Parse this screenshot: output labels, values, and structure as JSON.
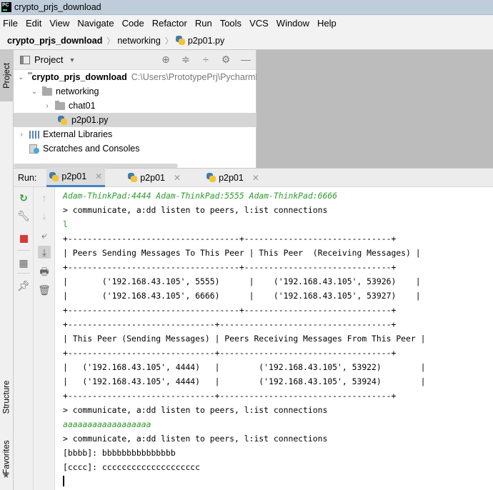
{
  "window": {
    "title": "crypto_prjs_download"
  },
  "menu": [
    {
      "label": "File"
    },
    {
      "label": "Edit"
    },
    {
      "label": "View"
    },
    {
      "label": "Navigate"
    },
    {
      "label": "Code"
    },
    {
      "label": "Refactor"
    },
    {
      "label": "Run"
    },
    {
      "label": "Tools"
    },
    {
      "label": "VCS"
    },
    {
      "label": "Window"
    },
    {
      "label": "Help"
    }
  ],
  "breadcrumb": {
    "root": "crypto_prjs_download",
    "folder": "networking",
    "file": "p2p01.py"
  },
  "side_tabs": {
    "project": "Project",
    "structure": "Structure",
    "favorites": "Favorites"
  },
  "project_panel": {
    "title": "Project",
    "tree": [
      {
        "label": "crypto_prjs_download",
        "path": "C:\\Users\\PrototypePrj\\PycharmP"
      },
      {
        "label": "networking"
      },
      {
        "label": "chat01"
      },
      {
        "label": "p2p01.py"
      },
      {
        "label": "External Libraries"
      },
      {
        "label": "Scratches and Consoles"
      }
    ]
  },
  "run": {
    "label": "Run:",
    "tabs": [
      {
        "label": "p2p01"
      },
      {
        "label": "p2p01"
      },
      {
        "label": "p2p01"
      }
    ]
  },
  "console": {
    "lines": [
      "Adam-ThinkPad:4444 Adam-ThinkPad:5555 Adam-ThinkPad:6666",
      "> communicate, a:dd listen to peers, l:ist connections",
      "l",
      "+-----------------------------------+------------------------------+",
      "| Peers Sending Messages To This Peer | This Peer  (Receiving Messages) |",
      "+-----------------------------------+------------------------------+",
      "|       ('192.168.43.105', 5555)      |    ('192.168.43.105', 53926)    |",
      "|       ('192.168.43.105', 6666)      |    ('192.168.43.105', 53927)    |",
      "+-----------------------------------+------------------------------+",
      "+------------------------------+-----------------------------------+",
      "| This Peer (Sending Messages) | Peers Receiving Messages From This Peer |",
      "+------------------------------+-----------------------------------+",
      "|   ('192.168.43.105', 4444)   |        ('192.168.43.105', 53922)        |",
      "|   ('192.168.43.105', 4444)   |        ('192.168.43.105', 53924)        |",
      "+------------------------------+-----------------------------------+",
      "> communicate, a:dd listen to peers, l:ist connections",
      "aaaaaaaaaaaaaaaaaa",
      "> communicate, a:dd listen to peers, l:ist connections",
      "[bbbb]: bbbbbbbbbbbbbbb",
      "[cccc]: cccccccccccccccccccc"
    ]
  },
  "colors": {
    "accent": "#4083c9",
    "console_green": "#2d9a2d",
    "stop_red": "#d63b3b"
  }
}
